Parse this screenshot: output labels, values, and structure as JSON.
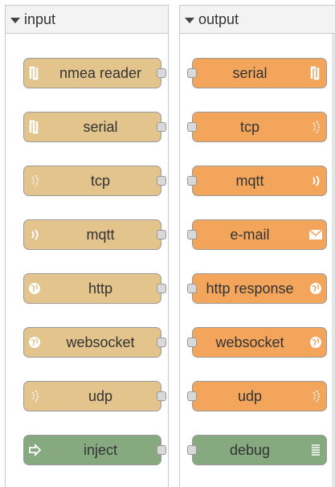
{
  "input_category": {
    "label": "input",
    "nodes": [
      {
        "label": "nmea reader",
        "icon": "serial-icon",
        "color": "#e2c48c"
      },
      {
        "label": "serial",
        "icon": "serial-icon",
        "color": "#e2c48c"
      },
      {
        "label": "tcp",
        "icon": "wave-icon",
        "color": "#e2c48c"
      },
      {
        "label": "mqtt",
        "icon": "wave-icon",
        "color": "#e2c48c"
      },
      {
        "label": "http",
        "icon": "globe-icon",
        "color": "#e2c48c"
      },
      {
        "label": "websocket",
        "icon": "globe-icon",
        "color": "#e2c48c"
      },
      {
        "label": "udp",
        "icon": "wave-icon",
        "color": "#e2c48c"
      },
      {
        "label": "inject",
        "icon": "arrow-in-icon",
        "color": "#87a980"
      }
    ]
  },
  "output_category": {
    "label": "output",
    "nodes": [
      {
        "label": "serial",
        "icon": "serial-icon",
        "color": "#f3a55c"
      },
      {
        "label": "tcp",
        "icon": "wave-icon",
        "color": "#f3a55c"
      },
      {
        "label": "mqtt",
        "icon": "wave-icon",
        "color": "#f3a55c"
      },
      {
        "label": "e-mail",
        "icon": "envelope-icon",
        "color": "#f3a55c"
      },
      {
        "label": "http response",
        "icon": "globe-icon",
        "color": "#f3a55c"
      },
      {
        "label": "websocket",
        "icon": "globe-icon",
        "color": "#f3a55c"
      },
      {
        "label": "udp",
        "icon": "wave-icon",
        "color": "#f3a55c"
      },
      {
        "label": "debug",
        "icon": "list-icon",
        "color": "#87a980"
      }
    ]
  }
}
